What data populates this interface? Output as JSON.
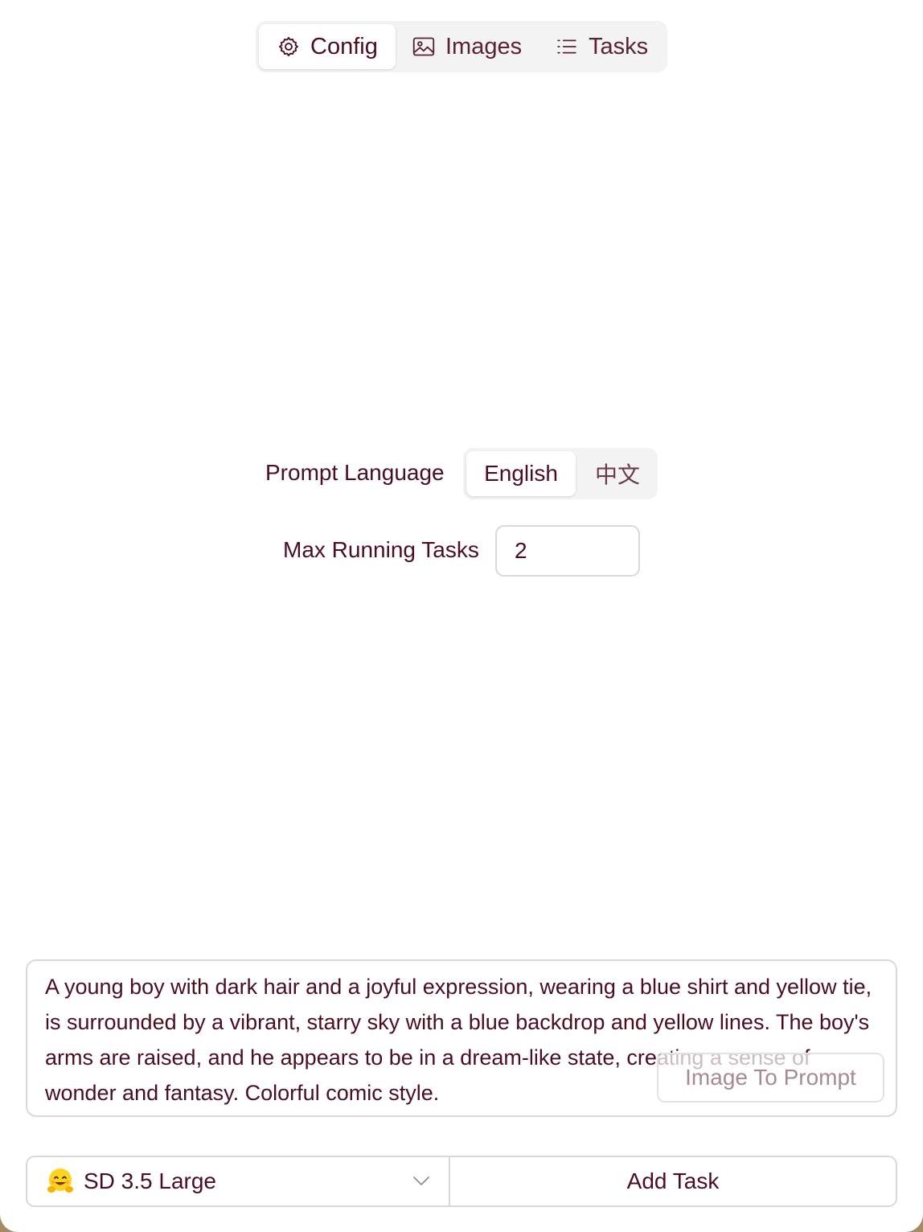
{
  "tabs": [
    {
      "label": "Config",
      "icon": "gear-icon",
      "active": true
    },
    {
      "label": "Images",
      "icon": "image-icon",
      "active": false
    },
    {
      "label": "Tasks",
      "icon": "list-icon",
      "active": false
    }
  ],
  "config": {
    "prompt_language_label": "Prompt Language",
    "languages": [
      {
        "label": "English",
        "active": true
      },
      {
        "label": "中文",
        "active": false
      }
    ],
    "max_running_tasks_label": "Max Running Tasks",
    "max_running_tasks_value": "2"
  },
  "prompt": {
    "text": "A young boy with dark hair and a joyful expression, wearing a blue shirt and yellow tie, is surrounded by a vibrant, starry sky with a blue backdrop and yellow lines. The boy's arms are raised, and he appears to be in a dream-like state, creating a sense of wonder and fantasy. Colorful comic style.",
    "image_to_prompt_label": "Image To Prompt"
  },
  "bottom": {
    "model_emoji": "hugging-face-emoji",
    "model_label": "SD 3.5 Large",
    "add_task_label": "Add Task"
  },
  "colors": {
    "text": "#4a0e1f",
    "segment_bg": "#f3f3f3",
    "border": "#d9d9d9",
    "desktop_bg": "#a58a63"
  }
}
